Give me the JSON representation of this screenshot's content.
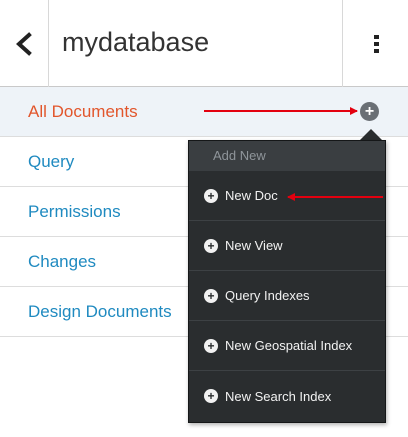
{
  "header": {
    "back_icon": "chevron-left-icon",
    "database_name": "mydatabase",
    "menu_icon": "vertical-ellipsis-icon"
  },
  "nav": {
    "items": [
      {
        "label": "All Documents",
        "active": true
      },
      {
        "label": "Query",
        "active": false
      },
      {
        "label": "Permissions",
        "active": false
      },
      {
        "label": "Changes",
        "active": false
      },
      {
        "label": "Design Documents",
        "active": false
      }
    ],
    "add_icon": "plus-circle-icon"
  },
  "dropdown": {
    "header": "Add New",
    "items": [
      {
        "label": "New Doc",
        "icon": "plus-circle-icon"
      },
      {
        "label": "New View",
        "icon": "plus-circle-icon"
      },
      {
        "label": "Query Indexes",
        "icon": "plus-circle-icon"
      },
      {
        "label": "New Geospatial Index",
        "icon": "plus-circle-icon"
      },
      {
        "label": "New Search Index",
        "icon": "plus-circle-icon"
      }
    ]
  },
  "colors": {
    "active_nav": "#e2562c",
    "nav_link": "#1f8ac0",
    "dropdown_bg": "#2a2d2f",
    "annotation_arrow": "#e3000f"
  }
}
